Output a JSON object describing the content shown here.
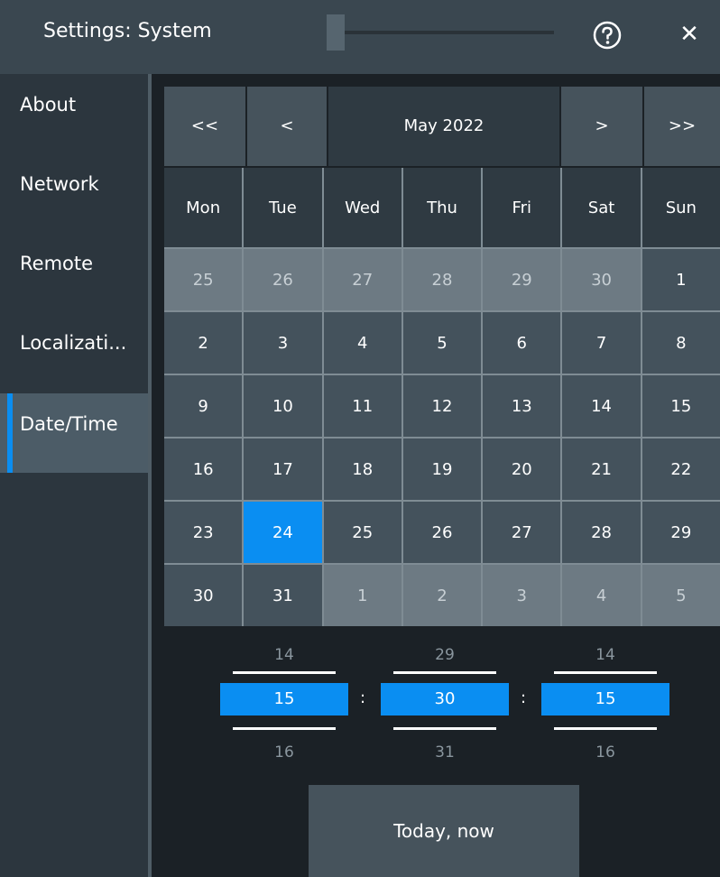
{
  "window": {
    "title": "Settings: System",
    "close_symbol": "✕",
    "help_icon": "help-circle-icon",
    "close_icon": "close-icon"
  },
  "sidebar": {
    "items": [
      {
        "label": "About",
        "active": false
      },
      {
        "label": "Network",
        "active": false
      },
      {
        "label": "Remote",
        "active": false
      },
      {
        "label": "Localizati...",
        "active": false
      },
      {
        "label": "Date/Time",
        "active": true
      }
    ]
  },
  "calendar": {
    "prev_year": "<<",
    "prev_month": "<",
    "month_label": "May 2022",
    "next_month": ">",
    "next_year": ">>",
    "weekdays": [
      "Mon",
      "Tue",
      "Wed",
      "Thu",
      "Fri",
      "Sat",
      "Sun"
    ],
    "weeks": [
      [
        "25",
        "26",
        "27",
        "28",
        "29",
        "30",
        "1"
      ],
      [
        "2",
        "3",
        "4",
        "5",
        "6",
        "7",
        "8"
      ],
      [
        "9",
        "10",
        "11",
        "12",
        "13",
        "14",
        "15"
      ],
      [
        "16",
        "17",
        "18",
        "19",
        "20",
        "21",
        "22"
      ],
      [
        "23",
        "24",
        "25",
        "26",
        "27",
        "28",
        "29"
      ],
      [
        "30",
        "31",
        "1",
        "2",
        "3",
        "4",
        "5"
      ]
    ],
    "selected_day": "24"
  },
  "time": {
    "hour": {
      "prev": "14",
      "value": "15",
      "next": "16"
    },
    "minute": {
      "prev": "29",
      "value": "30",
      "next": "31"
    },
    "second": {
      "prev": "14",
      "value": "15",
      "next": "16"
    },
    "separator": ":"
  },
  "actions": {
    "today_now_label": "Today, now"
  },
  "colors": {
    "accent": "#0a8ef2",
    "title_bar": "#3a4750",
    "cell": "#44525c",
    "other_month_cell": "#6d7a83"
  }
}
